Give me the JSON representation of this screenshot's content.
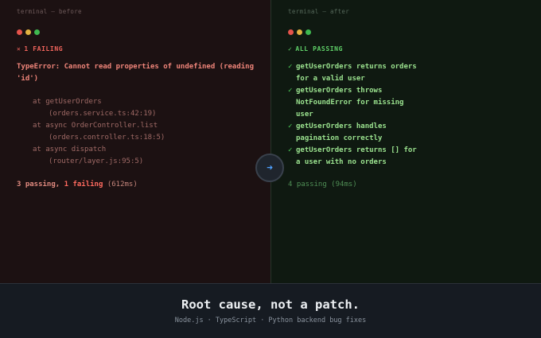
{
  "before": {
    "label": "terminal — before",
    "status_glyph": "✕",
    "status": "1 FAILING",
    "error": "TypeError: Cannot read properties of undefined (reading 'id')",
    "stack": [
      {
        "fn": "at getUserOrders",
        "loc": "(orders.service.ts:42:19)"
      },
      {
        "fn": "at async OrderController.list",
        "loc": "(orders.controller.ts:18:5)"
      },
      {
        "fn": "at async dispatch",
        "loc": "(router/layer.js:95:5)"
      }
    ],
    "summary": {
      "passing": "3 passing,",
      "failing": "1 failing",
      "time": "(612ms)"
    }
  },
  "after": {
    "label": "terminal — after",
    "status_glyph": "✓",
    "status": "ALL PASSING",
    "tests": [
      {
        "check": "✓",
        "name": "getUserOrders returns orders for a valid user"
      },
      {
        "check": "✓",
        "name": "getUserOrders throws NotFoundError for missing user"
      },
      {
        "check": "✓",
        "name": "getUserOrders handles pagination correctly"
      },
      {
        "check": "✓",
        "name": "getUserOrders returns [] for a user with no orders"
      }
    ],
    "summary": "4 passing (94ms)"
  },
  "arrow": {
    "icon": "arrow-right-icon",
    "glyph": "➜"
  },
  "footer": {
    "tagline": "Root cause, not a patch.",
    "subline": "Node.js · TypeScript · Python backend bug fixes"
  },
  "colors": {
    "failing": "#f0645c",
    "passing": "#5fd068",
    "accent": "#4fa1ff"
  }
}
